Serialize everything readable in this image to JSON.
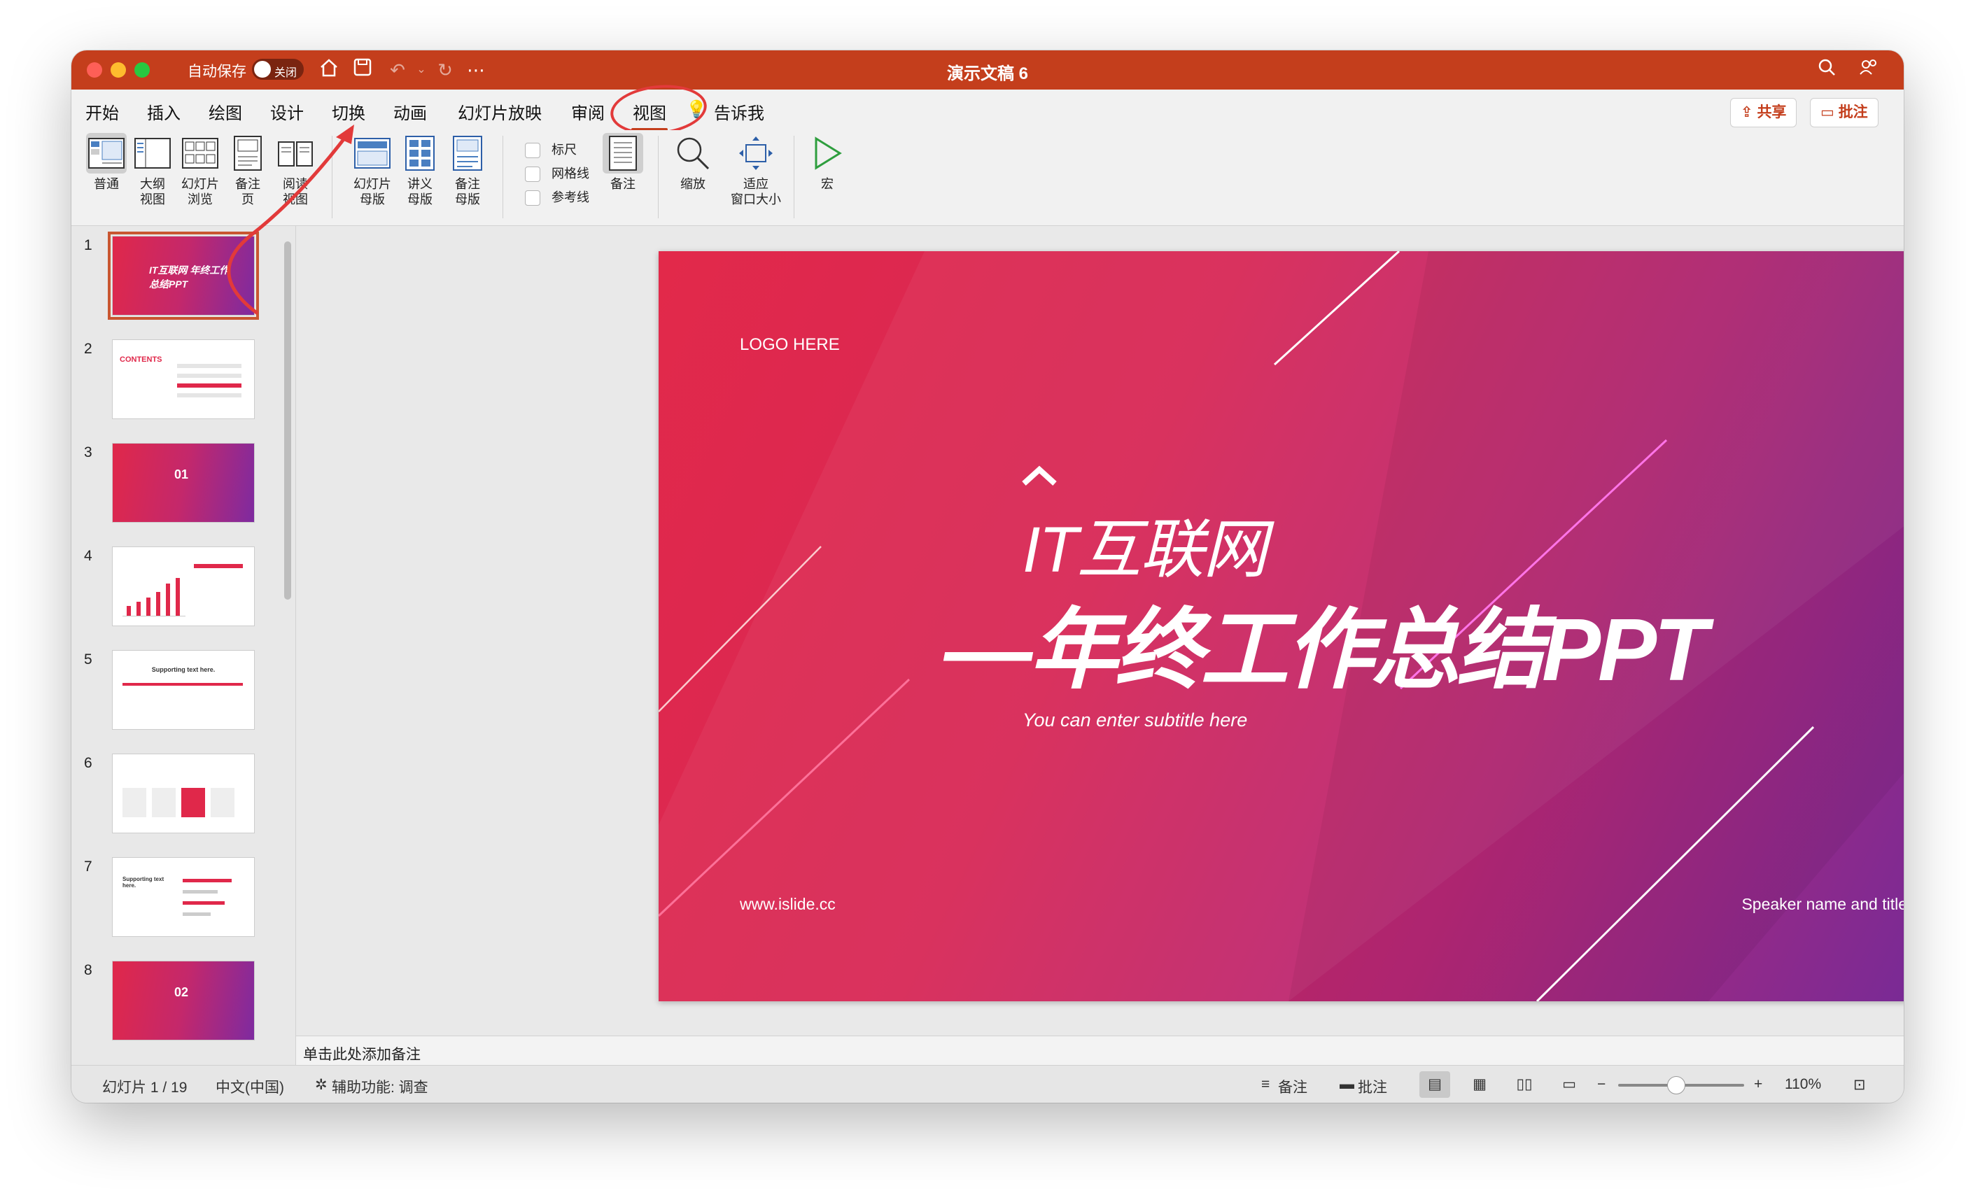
{
  "window": {
    "title": "演示文稿 6",
    "autosave_label": "自动保存",
    "autosave_toggle": "关闭"
  },
  "menu": {
    "items": [
      "开始",
      "插入",
      "绘图",
      "设计",
      "切换",
      "动画",
      "幻灯片放映",
      "审阅",
      "视图"
    ],
    "tell_me": "告诉我",
    "active": "视图",
    "share_label": "共享",
    "comments_label": "批注"
  },
  "ribbon": {
    "views": [
      {
        "label": "普通",
        "icon": "normal-view-icon"
      },
      {
        "label": "大纲\n视图",
        "icon": "outline-view-icon"
      },
      {
        "label": "幻灯片\n浏览",
        "icon": "slide-sorter-icon"
      },
      {
        "label": "备注\n页",
        "icon": "notes-page-icon"
      },
      {
        "label": "阅读\n视图",
        "icon": "reading-view-icon"
      }
    ],
    "masters": [
      {
        "label": "幻灯片\n母版",
        "icon": "slide-master-icon"
      },
      {
        "label": "讲义\n母版",
        "icon": "handout-master-icon"
      },
      {
        "label": "备注\n母版",
        "icon": "notes-master-icon"
      }
    ],
    "show_checks": [
      "标尺",
      "网格线",
      "参考线"
    ],
    "notes_label": "备注",
    "zoom_label": "缩放",
    "fit_label": "适应\n窗口大小",
    "macro_label": "宏"
  },
  "thumbnails": [
    {
      "num": "1",
      "kind": "title",
      "text": "IT互联网 年终工作总结PPT",
      "selected": true
    },
    {
      "num": "2",
      "kind": "contents",
      "text": "CONTENTS"
    },
    {
      "num": "3",
      "kind": "section",
      "text": "01"
    },
    {
      "num": "4",
      "kind": "chart",
      "text": ""
    },
    {
      "num": "5",
      "kind": "timeline",
      "text": "Supporting text here."
    },
    {
      "num": "6",
      "kind": "cards",
      "text": ""
    },
    {
      "num": "7",
      "kind": "bars",
      "text": "Supporting text here."
    },
    {
      "num": "8",
      "kind": "section",
      "text": "02"
    }
  ],
  "slide": {
    "logo": "LOGO HERE",
    "title_line1": "IT互联网",
    "title_line2": "—年终工作总结PPT",
    "subtitle": "You can enter subtitle here",
    "url": "www.islide.cc",
    "speaker": "Speaker name and title"
  },
  "notes_placeholder": "单击此处添加备注",
  "status": {
    "slide_counter": "幻灯片 1 / 19",
    "language": "中文(中国)",
    "accessibility": "辅助功能: 调查",
    "notes_btn": "备注",
    "comments_btn": "批注",
    "zoom": "110%"
  },
  "colors": {
    "accent": "#c43e1c",
    "slide_gradient_start": "#e2294a",
    "slide_gradient_end": "#6f2b9a"
  }
}
